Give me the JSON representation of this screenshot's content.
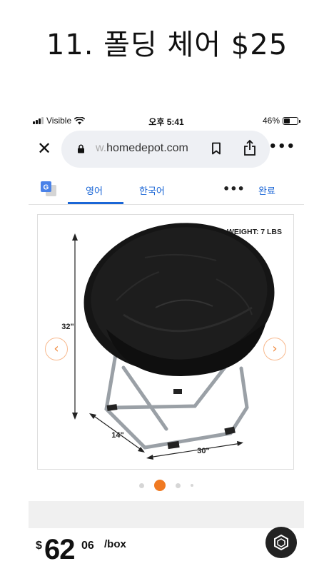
{
  "caption": "11. 폴딩 체어 $25",
  "status_bar": {
    "carrier": "Visible",
    "time": "오후 5:41",
    "battery": "46%",
    "battery_level": 0.46
  },
  "browser": {
    "url_prefix": "w.",
    "url_domain": "homedepot.com",
    "more_label": "•••"
  },
  "translate_bar": {
    "source_lang": "영어",
    "target_lang": "한국어",
    "more_label": "•••",
    "done_label": "완료"
  },
  "product_image": {
    "weight_label": "WEIGHT: 7 LBS",
    "dim_height": "32\"",
    "dim_depth": "14\"",
    "dim_width": "30\"",
    "prev_label": "‹",
    "next_label": "›"
  },
  "carousel": {
    "count": 4,
    "active_index": 1
  },
  "price": {
    "currency": "$",
    "whole": "62",
    "cents": "06",
    "unit": "/box"
  }
}
